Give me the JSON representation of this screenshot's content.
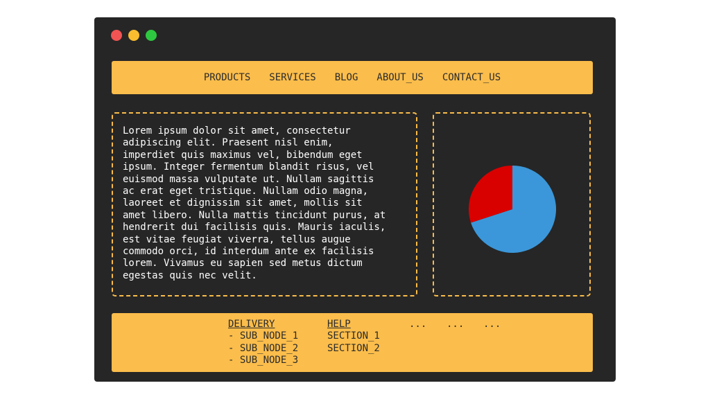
{
  "colors": {
    "window_bg": "#262626",
    "accent": "#fbbd4b",
    "dot_close": "#f25353",
    "dot_minimize": "#fbbd2f",
    "dot_maximize": "#2ec840",
    "pie_blue": "#3b97d9",
    "pie_red": "#d90000"
  },
  "nav": {
    "items": [
      "PRODUCTS",
      "SERVICES",
      "BLOG",
      "ABOUT_US",
      "CONTACT_US"
    ]
  },
  "content": {
    "paragraph": "Lorem ipsum dolor sit amet, consectetur\nadipiscing elit. Praesent nisl enim,\nimperdiet quis maximus vel, bibendum eget\nipsum. Integer fermentum blandit risus, vel\neuismod massa vulputate ut. Nullam sagittis\nac erat eget tristique. Nullam odio magna,\nlaoreet et dignissim sit amet, mollis sit\namet libero. Nulla mattis tincidunt purus, at\nhendrerit dui facilisis quis. Mauris iaculis,\nest vitae feugiat viverra, tellus augue\ncommodo orci, id interdum ante ex facilisis\nlorem. Vivamus eu sapien sed metus dictum\negestas quis nec velit."
  },
  "chart_data": {
    "type": "pie",
    "title": "",
    "slices": [
      {
        "value": 70,
        "color": "#3b97d9"
      },
      {
        "value": 30,
        "color": "#d90000"
      }
    ]
  },
  "footer": {
    "delivery": {
      "heading": "DELIVERY",
      "items": [
        "- SUB_NODE_1",
        "- SUB_NODE_2",
        "- SUB_NODE_3"
      ]
    },
    "help": {
      "heading": "HELP",
      "items": [
        "SECTION_1",
        "SECTION_2"
      ]
    },
    "ellipses": [
      "...",
      "...",
      "..."
    ]
  }
}
